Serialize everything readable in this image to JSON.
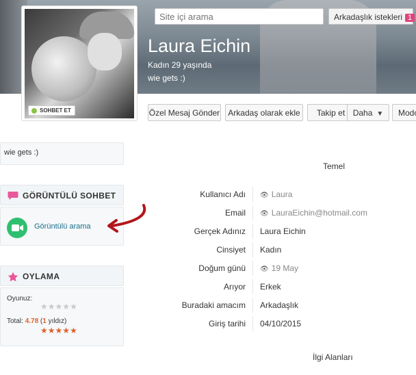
{
  "header": {
    "search_placeholder": "Site içi arama",
    "friend_requests_label": "Arkadaşlık istekleri",
    "friend_requests_count": "1"
  },
  "profile": {
    "name": "Laura Eichin",
    "subtitle": "Kadın 29 yaşında",
    "status": "wie gets :)",
    "chat_tag": "SOHBET ET"
  },
  "actions": {
    "private_message": "Özel Mesaj Gönder",
    "add_friend": "Arkadaş olarak ekle",
    "follow": "Takip et",
    "more": "Daha",
    "mode": "Modo"
  },
  "sidebar": {
    "status_text": "wie gets :)",
    "video_chat": {
      "title": "GÖRÜNTÜLÜ SOHBET",
      "link": "Görüntülü arama"
    },
    "voting": {
      "title": "OYLAMA",
      "your_vote_label": "Oyunuz:",
      "total_label": "Total:",
      "total_score": "4.78",
      "vote_count": "1",
      "vote_unit": "yıldız",
      "user_rating": 0,
      "total_rating": 5
    }
  },
  "info": {
    "section_basic": "Temel",
    "rows": [
      {
        "label": "Kullanıcı Adı",
        "value": "Laura",
        "private": true
      },
      {
        "label": "Email",
        "value": "LauraEichin@hotmail.com",
        "private": true
      },
      {
        "label": "Gerçek Adınız",
        "value": "Laura Eichin",
        "private": false
      },
      {
        "label": "Cinsiyet",
        "value": "Kadın",
        "private": false
      },
      {
        "label": "Doğum günü",
        "value": "19 May",
        "private": true
      },
      {
        "label": "Arıyor",
        "value": "Erkek",
        "private": false
      },
      {
        "label": "Buradaki amacım",
        "value": "Arkadaşlık",
        "private": false
      },
      {
        "label": "Giriş tarihi",
        "value": "04/10/2015",
        "private": false
      }
    ],
    "section_interests": "İlgi Alanları"
  },
  "colors": {
    "accent_pink": "#e0457b",
    "video_green": "#2fbf71",
    "star_orange": "#e0612a",
    "link_blue": "#1a6f8c",
    "annotation_red": "#b3151b"
  }
}
